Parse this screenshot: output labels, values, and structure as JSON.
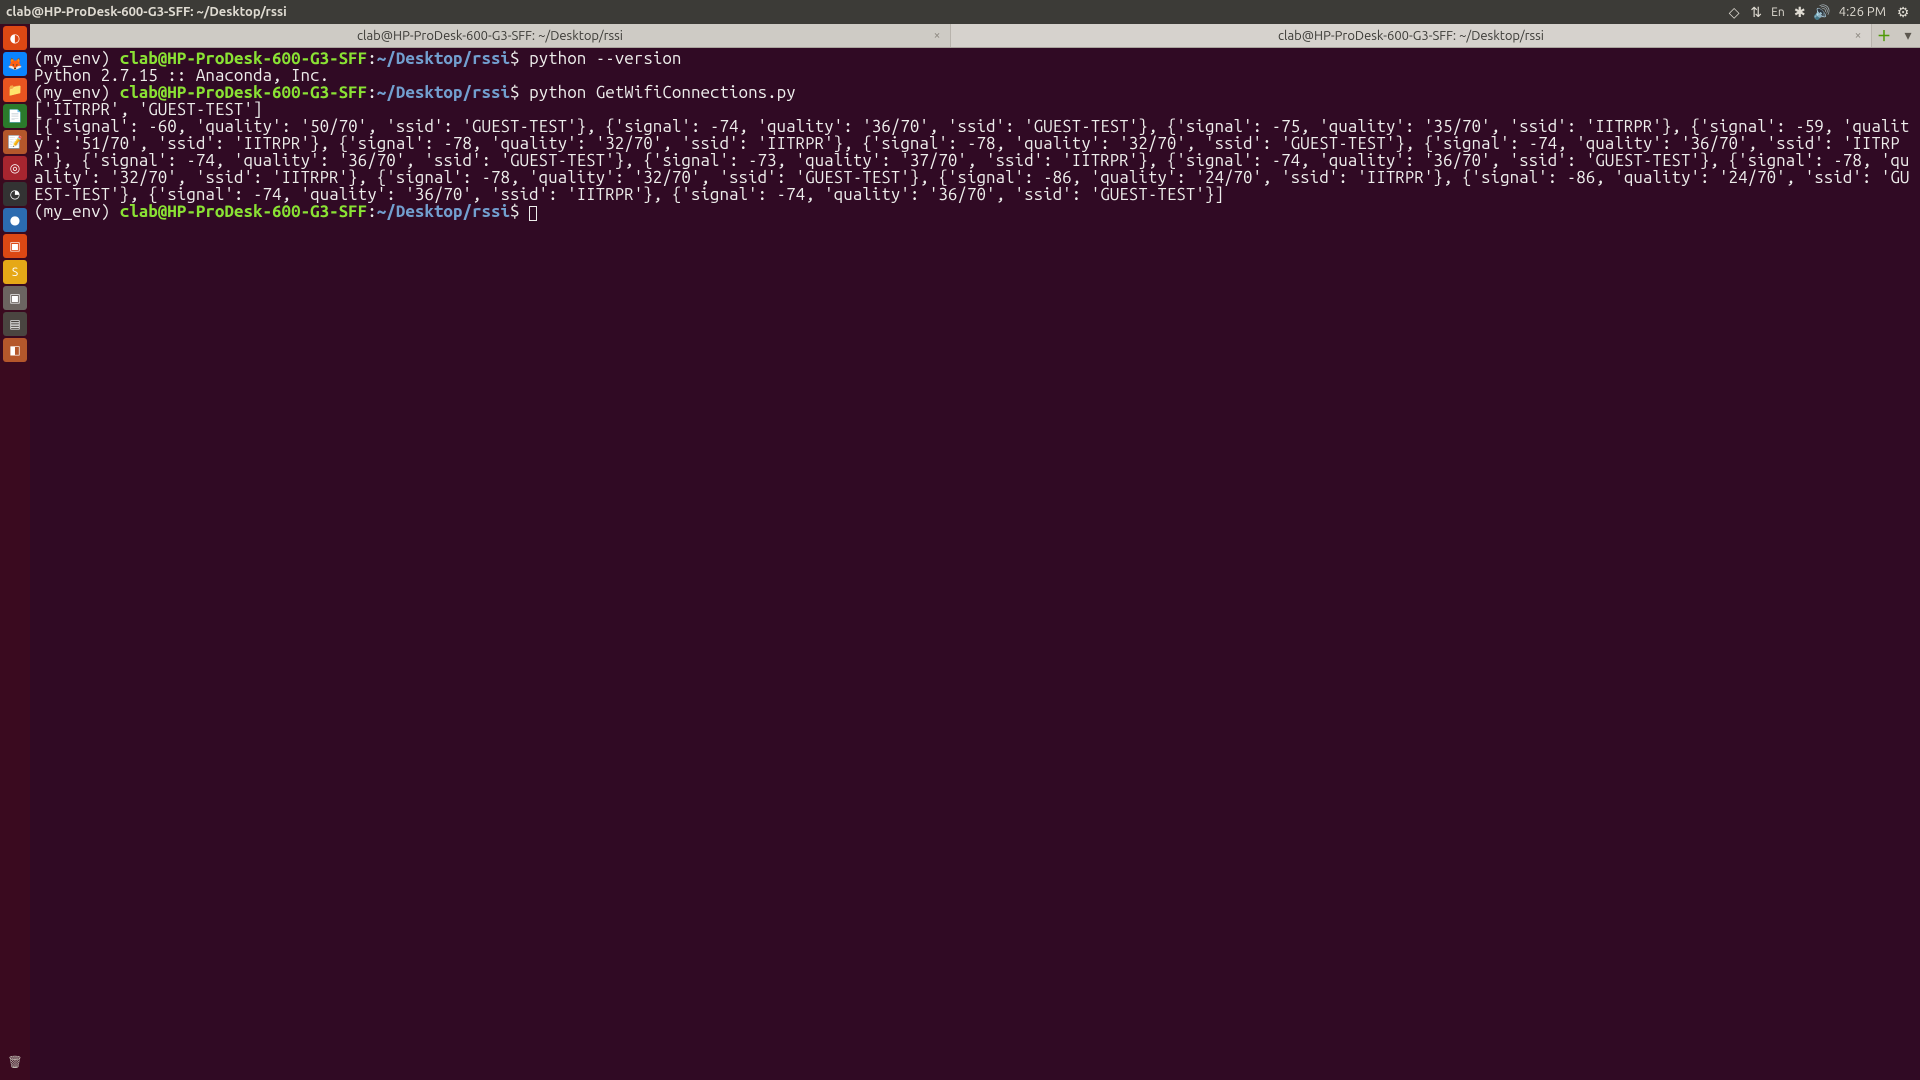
{
  "top_panel": {
    "window_title": "clab@HP-ProDesk-600-G3-SFF: ~/Desktop/rssi",
    "clock": "4:26 PM",
    "lang": "En"
  },
  "tabs": [
    {
      "label": "clab@HP-ProDesk-600-G3-SFF: ~/Desktop/rssi",
      "active": true
    },
    {
      "label": "clab@HP-ProDesk-600-G3-SFF: ~/Desktop/rssi",
      "active": false
    }
  ],
  "prompt": {
    "env": "(my_env)",
    "userhost": "clab@HP-ProDesk-600-G3-SFF",
    "path": "~/Desktop/rssi",
    "dollar": "$"
  },
  "lines": {
    "cmd1": "python --version",
    "out1": "Python 2.7.15 :: Anaconda, Inc.",
    "cmd2": "python GetWifiConnections.py",
    "out2": "['IITRPR', 'GUEST-TEST']",
    "out3": "[{'signal': -60, 'quality': '50/70', 'ssid': 'GUEST-TEST'}, {'signal': -74, 'quality': '36/70', 'ssid': 'GUEST-TEST'}, {'signal': -75, 'quality': '35/70', 'ssid': 'IITRPR'}, {'signal': -59, 'quality': '51/70', 'ssid': 'IITRPR'}, {'signal': -78, 'quality': '32/70', 'ssid': 'IITRPR'}, {'signal': -78, 'quality': '32/70', 'ssid': 'GUEST-TEST'}, {'signal': -74, 'quality': '36/70', 'ssid': 'IITRPR'}, {'signal': -74, 'quality': '36/70', 'ssid': 'GUEST-TEST'}, {'signal': -73, 'quality': '37/70', 'ssid': 'IITRPR'}, {'signal': -74, 'quality': '36/70', 'ssid': 'GUEST-TEST'}, {'signal': -78, 'quality': '32/70', 'ssid': 'IITRPR'}, {'signal': -78, 'quality': '32/70', 'ssid': 'GUEST-TEST'}, {'signal': -86, 'quality': '24/70', 'ssid': 'IITRPR'}, {'signal': -86, 'quality': '24/70', 'ssid': 'GUEST-TEST'}, {'signal': -74, 'quality': '36/70', 'ssid': 'IITRPR'}, {'signal': -74, 'quality': '36/70', 'ssid': 'GUEST-TEST'}]"
  }
}
